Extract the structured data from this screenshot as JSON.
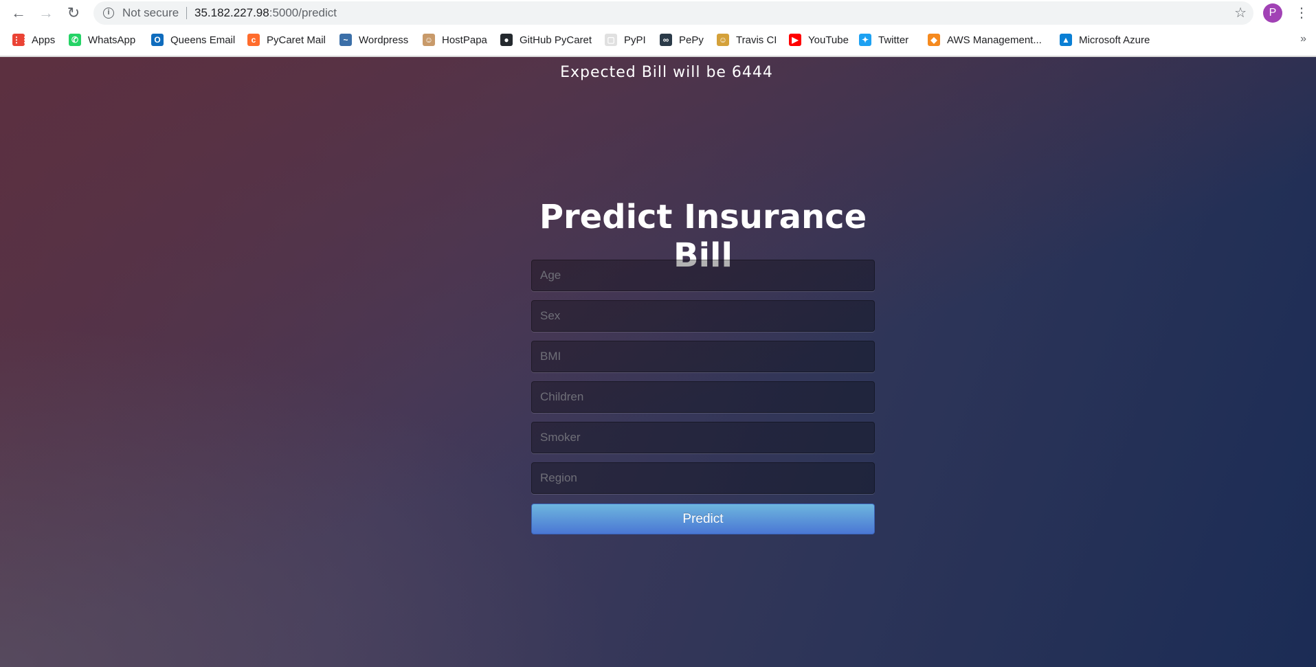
{
  "browser": {
    "security_label": "Not secure",
    "url_host": "35.182.227.98",
    "url_path": ":5000/predict",
    "profile_initial": "P",
    "bookmarks": [
      {
        "label": "Apps",
        "icon": "apps-grid-icon",
        "color": "#ea4335"
      },
      {
        "label": "WhatsApp",
        "icon": "whatsapp-icon",
        "color": "#25d366"
      },
      {
        "label": "Queens Email",
        "icon": "outlook-icon",
        "color": "#0f6cbd"
      },
      {
        "label": "PyCaret Mail",
        "icon": "cpanel-icon",
        "color": "#ff6c2c"
      },
      {
        "label": "Wordpress",
        "icon": "wordpress-icon",
        "color": "#3b6fa8"
      },
      {
        "label": "HostPapa",
        "icon": "hostpapa-icon",
        "color": "#c89a6a"
      },
      {
        "label": "GitHub PyCaret",
        "icon": "github-icon",
        "color": "#24292e"
      },
      {
        "label": "PyPI",
        "icon": "pypi-icon",
        "color": "#e0e0e0"
      },
      {
        "label": "PePy",
        "icon": "pepy-icon",
        "color": "#2b3a48"
      },
      {
        "label": "Travis CI",
        "icon": "travis-icon",
        "color": "#d4a13a"
      },
      {
        "label": "YouTube",
        "icon": "youtube-icon",
        "color": "#ff0000"
      },
      {
        "label": "Twitter",
        "icon": "twitter-icon",
        "color": "#1da1f2"
      },
      {
        "label": "AWS Management...",
        "icon": "aws-icon",
        "color": "#f58a1f"
      },
      {
        "label": "Microsoft Azure",
        "icon": "azure-icon",
        "color": "#0a7fd4"
      }
    ]
  },
  "page": {
    "result_text": "Expected Bill will be 6444",
    "title": "Predict Insurance Bill",
    "fields": [
      {
        "placeholder": "Age",
        "value": ""
      },
      {
        "placeholder": "Sex",
        "value": ""
      },
      {
        "placeholder": "BMI",
        "value": ""
      },
      {
        "placeholder": "Children",
        "value": ""
      },
      {
        "placeholder": "Smoker",
        "value": ""
      },
      {
        "placeholder": "Region",
        "value": ""
      }
    ],
    "submit_label": "Predict"
  }
}
